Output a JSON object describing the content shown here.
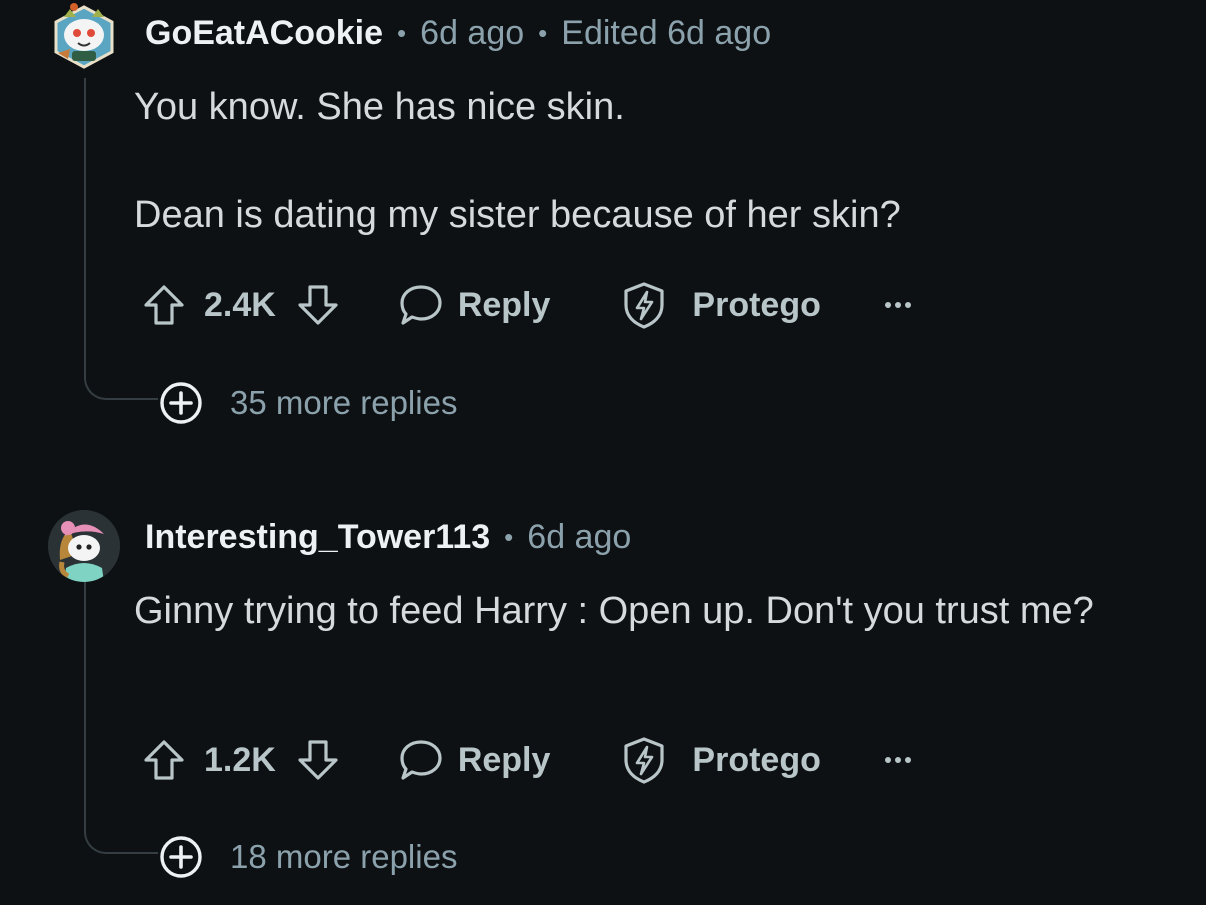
{
  "comments": [
    {
      "username": "GoEatACookie",
      "time": "6d ago",
      "edited": "Edited 6d ago",
      "paragraphs": [
        "You know. She has nice skin.",
        "Dean is dating my sister because of her skin?"
      ],
      "votes": "2.4K",
      "reply_label": "Reply",
      "award_label": "Protego",
      "more_replies": "35 more replies",
      "avatar_icon": "snoo-avatar-tiger-icon"
    },
    {
      "username": "Interesting_Tower113",
      "time": "6d ago",
      "paragraphs": [
        "Ginny trying to feed Harry : Open up. Don't you trust me?"
      ],
      "votes": "1.2K",
      "reply_label": "Reply",
      "award_label": "Protego",
      "more_replies": "18 more replies",
      "avatar_icon": "snoo-avatar-pink-hat-icon"
    }
  ],
  "icons": {
    "upvote": "arrow-up-icon",
    "downvote": "arrow-down-icon",
    "reply": "speech-bubble-icon",
    "award": "shield-lightning-icon",
    "more": "ellipsis-icon",
    "expand": "plus-circle-icon"
  },
  "colors": {
    "background": "#0e1113",
    "text": "#d7dadc",
    "meta": "#8ba2ad",
    "action": "#b8c5c9"
  }
}
